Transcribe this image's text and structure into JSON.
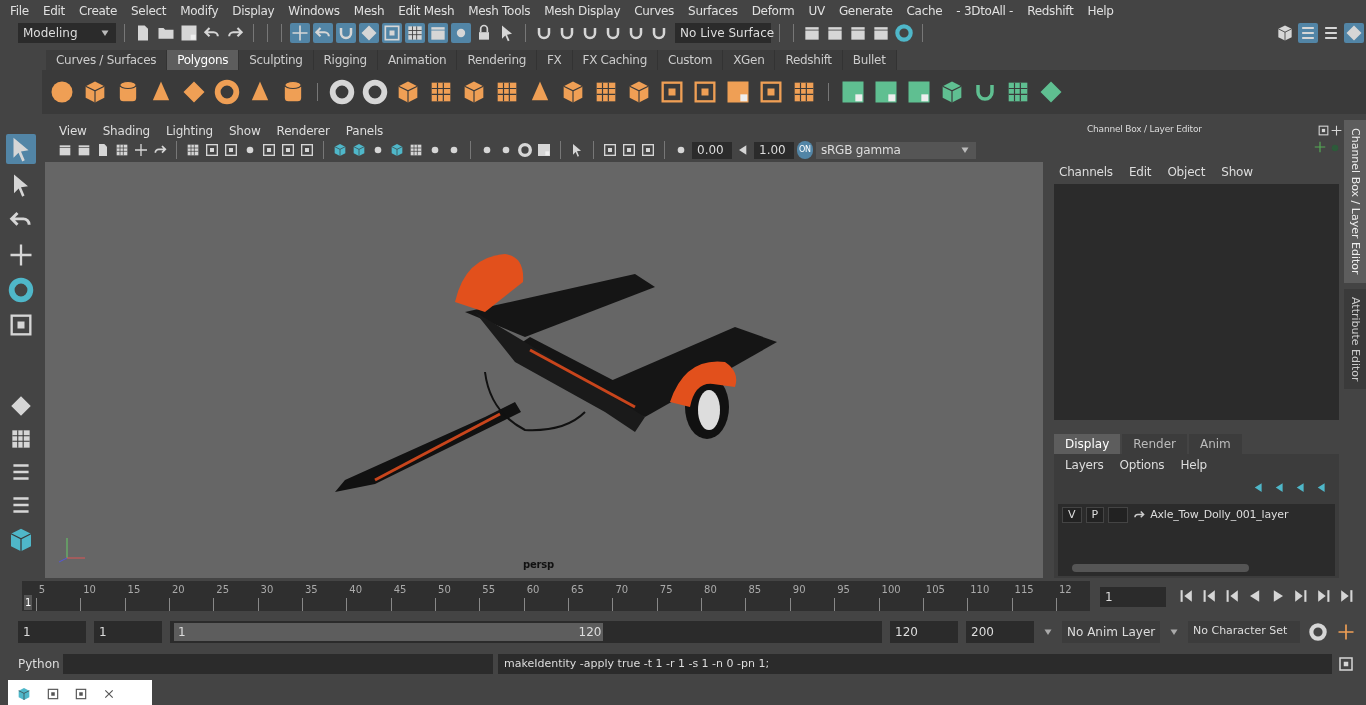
{
  "menu_bar": [
    "File",
    "Edit",
    "Create",
    "Select",
    "Modify",
    "Display",
    "Windows",
    "Mesh",
    "Edit Mesh",
    "Mesh Tools",
    "Mesh Display",
    "Curves",
    "Surfaces",
    "Deform",
    "UV",
    "Generate",
    "Cache",
    "- 3DtoAll -",
    "Redshift",
    "Help"
  ],
  "status_line": {
    "mode": "Modeling",
    "live_surface": "No Live Surface"
  },
  "shelf_tabs": [
    {
      "label": "Curves / Surfaces",
      "selected": false
    },
    {
      "label": "Polygons",
      "selected": true
    },
    {
      "label": "Sculpting",
      "selected": false
    },
    {
      "label": "Rigging",
      "selected": false
    },
    {
      "label": "Animation",
      "selected": false
    },
    {
      "label": "Rendering",
      "selected": false
    },
    {
      "label": "FX",
      "selected": false
    },
    {
      "label": "FX Caching",
      "selected": false
    },
    {
      "label": "Custom",
      "selected": false
    },
    {
      "label": "XGen",
      "selected": false
    },
    {
      "label": "Redshift",
      "selected": false
    },
    {
      "label": "Bullet",
      "selected": false
    }
  ],
  "viewport": {
    "menus": [
      "View",
      "Shading",
      "Lighting",
      "Show",
      "Renderer",
      "Panels"
    ],
    "exposure": "0.00",
    "gamma": "1.00",
    "color_toggle": "ON",
    "color_space": "sRGB gamma",
    "camera_label": "persp"
  },
  "channel_box": {
    "title": "Channel Box / Layer Editor",
    "menus": [
      "Channels",
      "Edit",
      "Object",
      "Show"
    ]
  },
  "layer_editor": {
    "tabs": [
      {
        "label": "Display",
        "selected": true
      },
      {
        "label": "Render",
        "selected": false
      },
      {
        "label": "Anim",
        "selected": false
      }
    ],
    "menus": [
      "Layers",
      "Options",
      "Help"
    ],
    "layers": [
      {
        "visibility": "V",
        "playback": "P",
        "name": "Axle_Tow_Dolly_001_layer"
      }
    ]
  },
  "side_tabs": [
    {
      "label": "Channel Box / Layer Editor",
      "selected": true
    },
    {
      "label": "Attribute Editor",
      "selected": false
    }
  ],
  "time_slider": {
    "ticks": [
      "5",
      "10",
      "15",
      "20",
      "25",
      "30",
      "35",
      "40",
      "45",
      "50",
      "55",
      "60",
      "65",
      "70",
      "75",
      "80",
      "85",
      "90",
      "95",
      "100",
      "105",
      "110",
      "115",
      "12"
    ],
    "current_marker": "1",
    "level": 0,
    "current_frame": "1"
  },
  "range": {
    "start": "1",
    "playback_start": "1",
    "slider_start": "1",
    "slider_end": "120",
    "level": 0.61,
    "playback_end": "120",
    "end": "200",
    "anim_layer": "No Anim Layer",
    "character_set": "No Character Set"
  },
  "command_line": {
    "language": "Python",
    "output": "makeIdentity -apply true -t 1 -r 1 -s 1 -n 0 -pn 1;"
  }
}
